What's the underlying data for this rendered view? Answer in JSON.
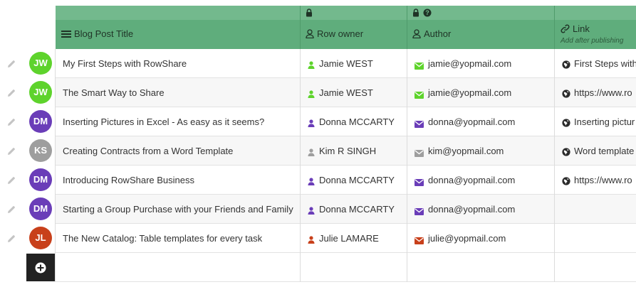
{
  "columns": {
    "title": {
      "label": "Blog Post Title"
    },
    "owner": {
      "label": "Row owner"
    },
    "author": {
      "label": "Author"
    },
    "link": {
      "label": "Link",
      "sublabel": "Add after publishing"
    }
  },
  "colors": {
    "header_top": "#73b98d",
    "header_main": "#5fad7c",
    "user_JW": "#5ed32c",
    "user_DM": "#6a3db8",
    "user_KS": "#9e9e9e",
    "user_JL": "#c8401b"
  },
  "rows": [
    {
      "initials": "JW",
      "title": "My First Steps with RowShare",
      "owner": "Jamie WEST",
      "author": "jamie@yopmail.com",
      "link": "First Steps with"
    },
    {
      "initials": "JW",
      "title": "The Smart Way to Share",
      "owner": "Jamie WEST",
      "author": "jamie@yopmail.com",
      "link": "https://www.ro"
    },
    {
      "initials": "DM",
      "title": "Inserting Pictures in Excel - As easy as it seems?",
      "owner": "Donna MCCARTY",
      "author": "donna@yopmail.com",
      "link": "Inserting pictur"
    },
    {
      "initials": "KS",
      "title": "Creating Contracts from a Word Template",
      "owner": "Kim R SINGH",
      "author": "kim@yopmail.com",
      "link": "Word template"
    },
    {
      "initials": "DM",
      "title": "Introducing RowShare Business",
      "owner": "Donna MCCARTY",
      "author": "donna@yopmail.com",
      "link": "https://www.ro"
    },
    {
      "initials": "DM",
      "title": "Starting a Group Purchase with your Friends and Family",
      "owner": "Donna MCCARTY",
      "author": "donna@yopmail.com",
      "link": ""
    },
    {
      "initials": "JL",
      "title": "The New Catalog: Table templates for every task",
      "owner": "Julie LAMARE",
      "author": "julie@yopmail.com",
      "link": ""
    }
  ]
}
